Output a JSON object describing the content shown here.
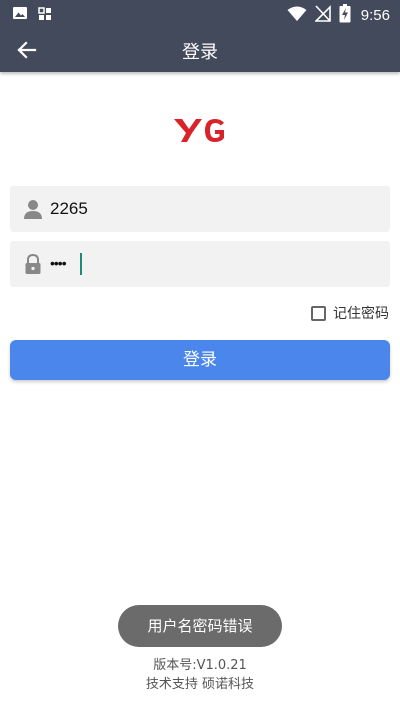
{
  "status_bar": {
    "time": "9:56",
    "icons": [
      "image-icon",
      "app-notification-icon",
      "wifi-icon",
      "no-signal-icon",
      "battery-charging-icon"
    ]
  },
  "app_bar": {
    "title": "登录"
  },
  "logo": {
    "text": "YG",
    "color": "#d8232a"
  },
  "form": {
    "username_value": "2265",
    "password_value": "••••",
    "remember_label": "记住密码",
    "remember_checked": false,
    "login_button_label": "登录"
  },
  "toast": {
    "message": "用户名密码错误"
  },
  "footer": {
    "version": "版本号:V1.0.21",
    "support": "技术支持  硕诺科技"
  },
  "colors": {
    "app_bar": "#434a5c",
    "primary_button": "#4a86ec",
    "field_background": "#f2f2f2",
    "caret": "#1f8a78"
  }
}
